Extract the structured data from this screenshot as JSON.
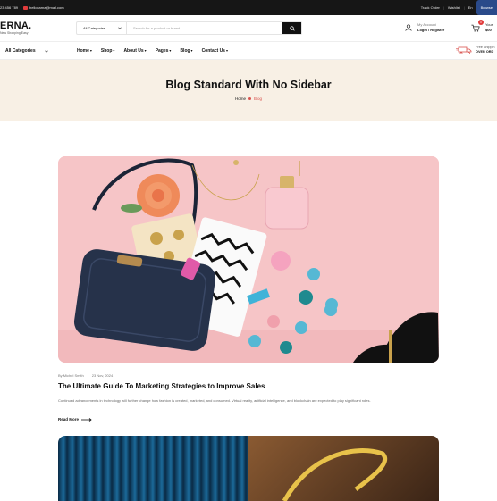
{
  "topbar": {
    "phone": "23 456 789",
    "email": "hellocarna@mail.com",
    "track_order": "Track Order",
    "wishlist": "Wishlist",
    "lang": "En",
    "browse": "Browse"
  },
  "header": {
    "logo_name": "ERNA.",
    "logo_tag": "New Shopping Easy",
    "category_label": "All Categories",
    "search_placeholder": "Search for a product or brand...",
    "account_label": "My Account",
    "account_links": "Login / Register",
    "cart_count": "0",
    "cart_label": "Your",
    "cart_total": "$00"
  },
  "nav": {
    "all_categories": "All Categories",
    "items": [
      {
        "label": "Home"
      },
      {
        "label": "Shop"
      },
      {
        "label": "About Us"
      },
      {
        "label": "Pages"
      },
      {
        "label": "Blog"
      },
      {
        "label": "Contact Us"
      }
    ],
    "shipping_line1": "Free Shippin",
    "shipping_line2": "OVER ORD"
  },
  "hero": {
    "title": "Blog Standard With No Sidebar",
    "breadcrumb_home": "Home",
    "breadcrumb_current": "Blog"
  },
  "post": {
    "author": "By Michel Smith",
    "divider": "|",
    "date": "23 Nov, 2024",
    "title": "The Ultimate Guide To Marketing Strategies to Improve Sales",
    "excerpt": "Continued advancements in technology will further change how fashion is created, marketed, and consumed. Virtual reality, artificial intelligence, and blockchain are expected to play significant roles.",
    "read_more": "Read More"
  },
  "colors": {
    "accent": "#d9534f",
    "hero_bg": "#f8f0e5",
    "topbar_bg": "#161616",
    "post_bg": "#f6c5c7"
  }
}
